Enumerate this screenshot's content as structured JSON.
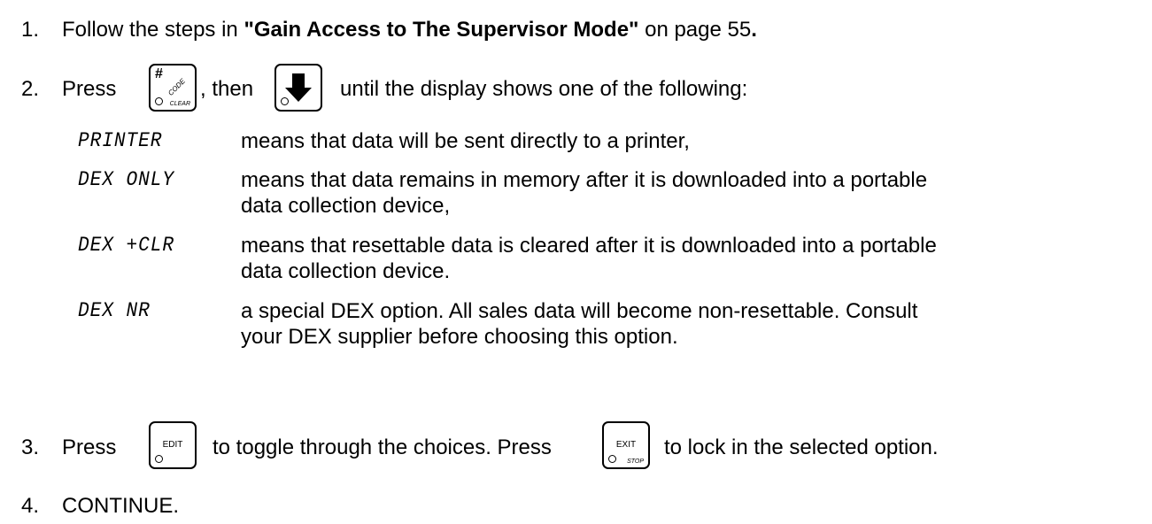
{
  "steps": {
    "s1": {
      "num": "1.",
      "pre": "Follow the steps in ",
      "bold": "\"Gain Access to The Supervisor Mode\"",
      "mid": " on page 55",
      "end": "."
    },
    "s2": {
      "num": "2.",
      "press": "Press",
      "then": ", then",
      "rest": "until the display shows one of the following:"
    },
    "s3": {
      "num": "3.",
      "press": "Press",
      "mid": "to toggle through the choices. Press",
      "end": "to lock in the selected option."
    },
    "s4": {
      "num": "4.",
      "text": "CONTINUE."
    }
  },
  "keys": {
    "code_key": {
      "hash": "#",
      "label": "CODE",
      "corner": "CLEAR",
      "icon": "hash-code-key-icon"
    },
    "down_key": {
      "icon": "down-arrow-icon"
    },
    "edit_key": {
      "label": "EDIT"
    },
    "exit_key": {
      "label": "EXIT",
      "corner": "STOP"
    }
  },
  "options": [
    {
      "term": "PRINTER",
      "desc": [
        "means that data will be sent directly to a printer,"
      ]
    },
    {
      "term": "DEX ONLY",
      "desc": [
        "means that data remains in memory after it is downloaded into a portable",
        "data collection device,"
      ]
    },
    {
      "term": "DEX +CLR",
      "desc": [
        "means that resettable data is cleared after it is downloaded into a portable",
        "data collection device."
      ]
    },
    {
      "term": "DEX NR",
      "desc": [
        "a special DEX option. All sales data will become non-resettable. Consult",
        "your DEX supplier before choosing this option."
      ]
    }
  ]
}
